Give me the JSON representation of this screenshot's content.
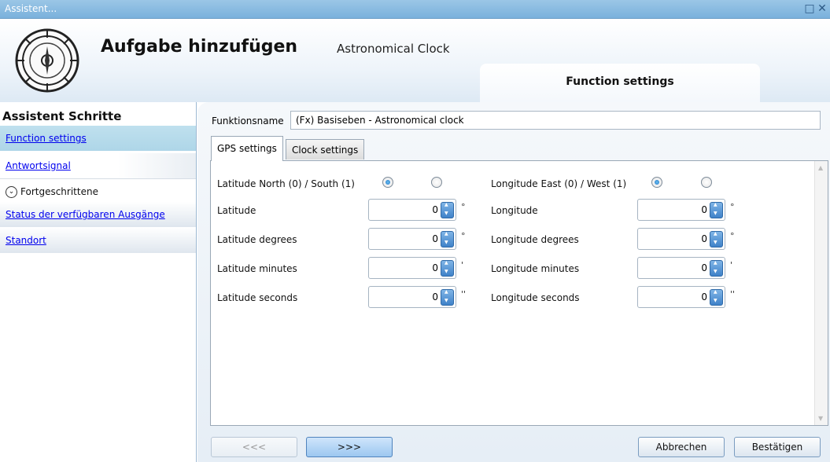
{
  "window": {
    "title": "Assistent...",
    "controls": [
      "□",
      "✕"
    ]
  },
  "header": {
    "title": "Aufgabe hinzufügen",
    "subtitle": "Astronomical Clock",
    "step_tab": "Function settings"
  },
  "sidebar": {
    "heading": "Assistent Schritte",
    "items": [
      {
        "label": "Function settings"
      },
      {
        "label": "Antwortsignal"
      },
      {
        "label": "Fortgeschrittene",
        "chevron": "⌄"
      },
      {
        "label": "Status der verfügbaren Ausgänge"
      },
      {
        "label": "Standort"
      }
    ]
  },
  "form": {
    "function_name_label": "Funktionsname",
    "function_name_value": "(Fx) Basiseben - Astronomical clock",
    "tabs": [
      "GPS settings",
      "Clock settings"
    ],
    "lat_ns_label": "Latitude North (0) / South (1)",
    "lon_ew_label": "Longitude East (0) / West (1)",
    "lat_ns_selected": 0,
    "lon_ew_selected": 0,
    "latitude": [
      {
        "label": "Latitude",
        "value": "0",
        "unit": "°"
      },
      {
        "label": "Latitude degrees",
        "value": "0",
        "unit": "°"
      },
      {
        "label": "Latitude minutes",
        "value": "0",
        "unit": "'"
      },
      {
        "label": "Latitude seconds",
        "value": "0",
        "unit": "''"
      }
    ],
    "longitude": [
      {
        "label": "Longitude",
        "value": "0",
        "unit": "°"
      },
      {
        "label": "Longitude degrees",
        "value": "0",
        "unit": "°"
      },
      {
        "label": "Longitude minutes",
        "value": "0",
        "unit": "'"
      },
      {
        "label": "Longitude seconds",
        "value": "0",
        "unit": "''"
      }
    ]
  },
  "footer": {
    "prev": "<<<",
    "next": ">>>",
    "cancel": "Abbrechen",
    "confirm": "Bestätigen"
  }
}
